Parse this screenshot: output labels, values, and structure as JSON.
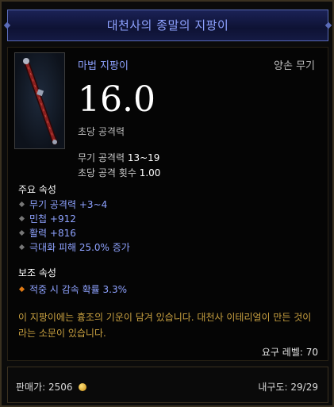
{
  "item": {
    "name": "대천사의 종말의 지팡이",
    "type": "마법 지팡이",
    "slot": "양손 무기",
    "dps": "16.0",
    "dps_label": "초당 공격력",
    "icon": "staff-icon"
  },
  "stats": [
    {
      "label": "무기 공격력",
      "value": "13~19"
    },
    {
      "label": "초당 공격 횟수",
      "value": "1.00"
    }
  ],
  "primary": {
    "heading": "주요 속성",
    "affixes": [
      "무기 공격력 +3~4",
      "민첩 +912",
      "활력 +816",
      "극대화 피해 25.0% 증가"
    ]
  },
  "secondary": {
    "heading": "보조 속성",
    "affixes": [
      "적중 시 감속 확률 3.3%"
    ]
  },
  "flavor": "이 지팡이에는 흉조의 기운이 담겨 있습니다. 대천사 이테리얼이 만든 것이라는 소문이 있습니다.",
  "requirement": "요구 레벨: 70",
  "footer": {
    "price_label": "판매가:",
    "price_value": "2506",
    "durability_label": "내구도:",
    "durability_value": "29/29"
  },
  "colors": {
    "title": "#8ea2ff",
    "magic": "#8ea2ff",
    "flavor": "#c8a040",
    "secondary_bullet": "#e07a14"
  }
}
